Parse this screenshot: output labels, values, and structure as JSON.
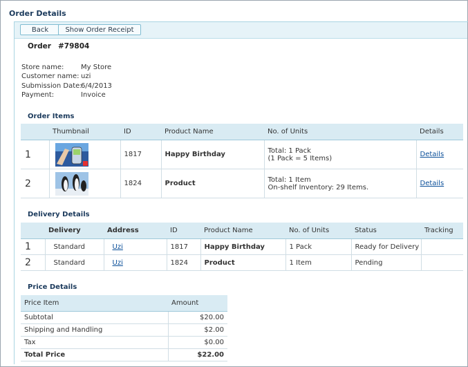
{
  "page_title": "Order Details",
  "toolbar": {
    "back_label": "Back",
    "receipt_label": "Show Order Receipt"
  },
  "order": {
    "label": "Order",
    "number": "#79804",
    "info": [
      {
        "label": "Store name:",
        "value": "My Store"
      },
      {
        "label": "Customer name:",
        "value": "uzi"
      },
      {
        "label": "Submission Date:",
        "value": "6/4/2013"
      },
      {
        "label": "Payment:",
        "value": "Invoice"
      }
    ]
  },
  "order_items": {
    "title": "Order Items",
    "headers": [
      "Thumbnail",
      "ID",
      "Product Name",
      "No. of Units",
      "Details"
    ],
    "rows": [
      {
        "index": "1",
        "thumbnail": "phone-ad-thumbnail",
        "id": "1817",
        "product": "Happy Birthday",
        "units1": "Total: 1 Pack",
        "units2": "(1 Pack = 5 Items)",
        "details": "Details"
      },
      {
        "index": "2",
        "thumbnail": "penguins-thumbnail",
        "id": "1824",
        "product": "Product",
        "units1": "Total: 1 Item",
        "units2": "On-shelf Inventory: 29 Items.",
        "details": "Details"
      }
    ]
  },
  "delivery": {
    "title": "Delivery Details",
    "headers": [
      "Delivery",
      "Address",
      "ID",
      "Product Name",
      "No. of Units",
      "Status",
      "Tracking"
    ],
    "rows": [
      {
        "index": "1",
        "delivery": "Standard",
        "address": "Uzi",
        "id": "1817",
        "product": "Happy Birthday",
        "units": "1 Pack",
        "status": "Ready for Delivery",
        "tracking": ""
      },
      {
        "index": "2",
        "delivery": "Standard",
        "address": "Uzi",
        "id": "1824",
        "product": "Product",
        "units": "1 Item",
        "status": "Pending",
        "tracking": ""
      }
    ]
  },
  "price": {
    "title": "Price Details",
    "headers": [
      "Price Item",
      "Amount"
    ],
    "rows": [
      {
        "item": "Subtotal",
        "amount": "$20.00"
      },
      {
        "item": "Shipping and Handling",
        "amount": "$2.00"
      },
      {
        "item": "Tax",
        "amount": "$0.00"
      }
    ],
    "total": {
      "item": "Total Price",
      "amount": "$22.00"
    }
  }
}
